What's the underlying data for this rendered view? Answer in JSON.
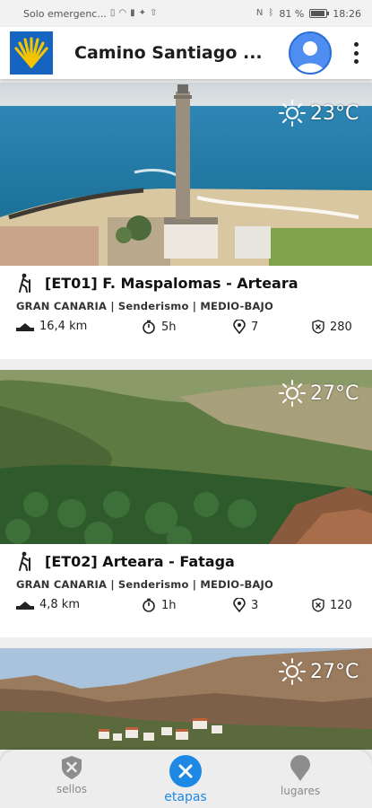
{
  "status_bar": {
    "carrier_text": "Solo emergenc...",
    "battery": "81 %",
    "time": "18:26"
  },
  "app_bar": {
    "title": "Camino Santiago ..."
  },
  "stages": [
    {
      "title": "[ET01] F. Maspalomas - Arteara",
      "meta": "GRAN CANARIA | Senderismo | MEDIO-BAJO",
      "temperature": "23°C",
      "distance": "16,4 km",
      "duration": "5h",
      "places": "7",
      "stamps": "280",
      "weather_icon": "sun-icon"
    },
    {
      "title": "[ET02] Arteara - Fataga",
      "meta": "GRAN CANARIA | Senderismo | MEDIO-BAJO",
      "temperature": "27°C",
      "distance": "4,8 km",
      "duration": "1h",
      "places": "3",
      "stamps": "120",
      "weather_icon": "sun-icon"
    },
    {
      "temperature": "27°C",
      "weather_icon": "sun-icon"
    }
  ],
  "bottom_nav": {
    "items": [
      {
        "label": "sellos",
        "icon": "shield-x-icon"
      },
      {
        "label": "etapas",
        "icon": "x-circle-icon"
      },
      {
        "label": "lugares",
        "icon": "map-pin-icon"
      }
    ],
    "active": "etapas"
  },
  "colors": {
    "accent": "#1e88e5",
    "logo_bg": "#1565c0",
    "logo_fg": "#f5c400"
  }
}
